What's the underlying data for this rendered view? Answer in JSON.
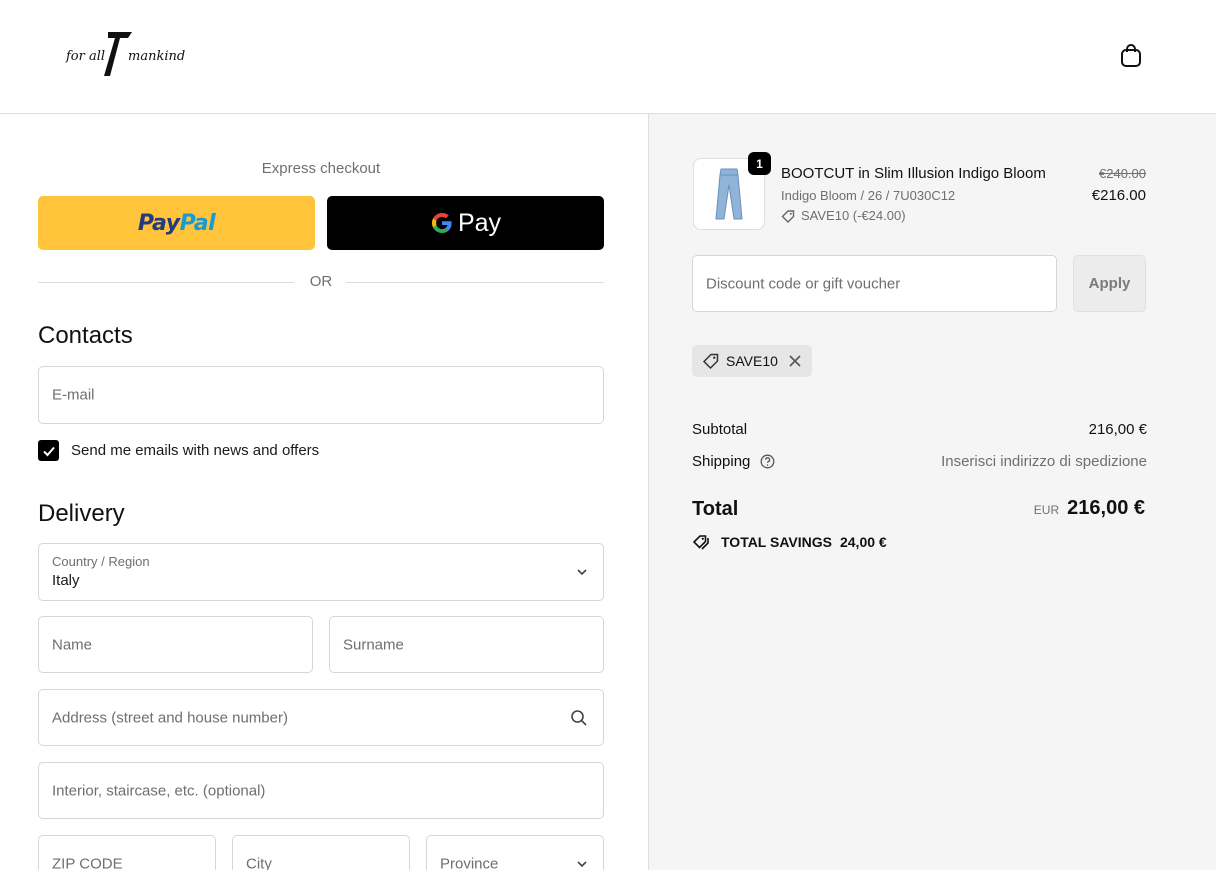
{
  "header": {
    "logo_text": "for all 7 mankind",
    "logo_icon": "brand-logo",
    "cart_icon": "shopping-bag-icon"
  },
  "express": {
    "title": "Express checkout",
    "paypal_label_a": "Pay",
    "paypal_label_b": "Pal",
    "gpay_label": "Pay",
    "or_text": "OR"
  },
  "contacts": {
    "title": "Contacts",
    "email_placeholder": "E-mail",
    "newsletter_label": "Send me emails with news and offers",
    "newsletter_checked": true
  },
  "delivery": {
    "title": "Delivery",
    "country_label": "Country / Region",
    "country_value": "Italy",
    "name_placeholder": "Name",
    "surname_placeholder": "Surname",
    "address_placeholder": "Address (street and house number)",
    "interior_placeholder": "Interior, staircase, etc. (optional)",
    "zip_placeholder": "ZIP CODE",
    "city_placeholder": "City",
    "province_placeholder": "Province"
  },
  "order": {
    "item": {
      "quantity": "1",
      "name": "BOOTCUT in Slim Illusion Indigo Bloom",
      "variant": "Indigo Bloom / 26 / 7U030C12",
      "discount": "SAVE10 (-€24.00)",
      "price_original": "€240.00",
      "price_final": "€216.00"
    },
    "discount_placeholder": "Discount code or gift voucher",
    "apply_label": "Apply",
    "applied_code": "SAVE10",
    "subtotal_label": "Subtotal",
    "subtotal_value": "216,00 €",
    "shipping_label": "Shipping",
    "shipping_value": "Inserisci indirizzo di spedizione",
    "total_label": "Total",
    "total_currency": "EUR",
    "total_value": "216,00 €",
    "savings_label": "TOTAL SAVINGS",
    "savings_value": "24,00 €"
  },
  "colors": {
    "paypal_yellow": "#ffc439",
    "paypal_dark_blue": "#253b80",
    "paypal_light_blue": "#179bd7",
    "summary_bg": "#f5f5f5"
  }
}
